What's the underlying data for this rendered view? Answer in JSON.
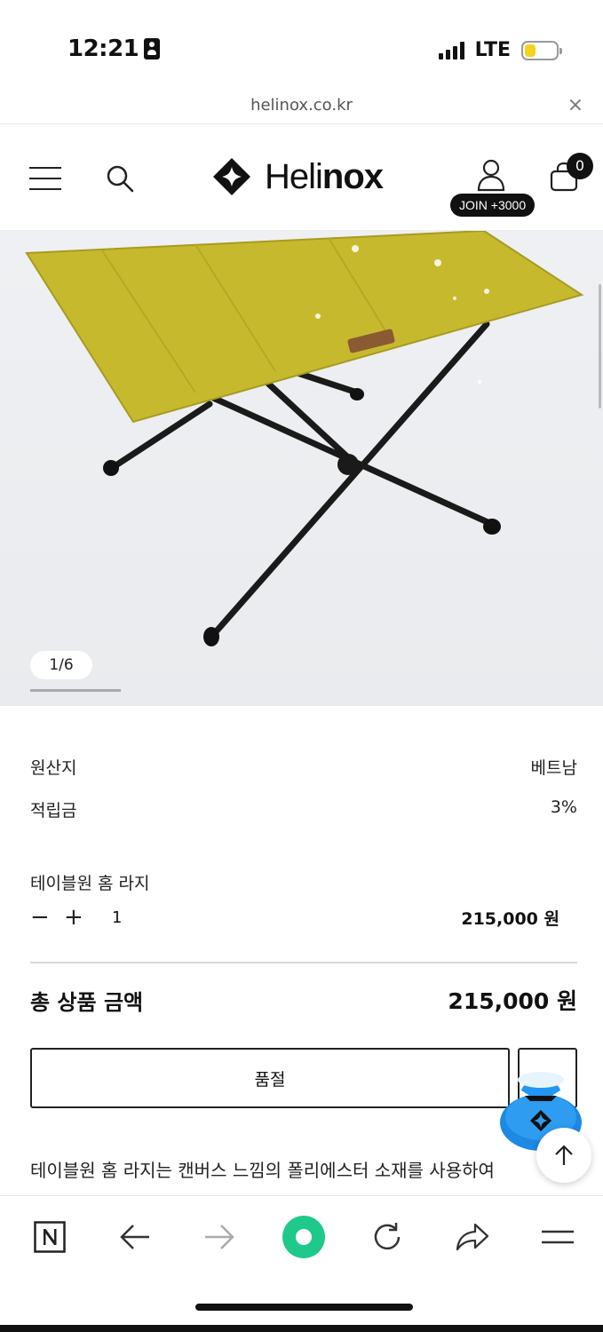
{
  "status_bar": {
    "time": "12:21",
    "network": "LTE",
    "battery_level": 0.35,
    "battery_color": "#f4d21f"
  },
  "browser": {
    "url": "helinox.co.kr",
    "close_symbol": "×"
  },
  "header": {
    "logo_light": "Heli",
    "logo_bold": "nox",
    "join_badge": "JOIN +3000",
    "cart_count": "0"
  },
  "product_gallery": {
    "counter": "1/6",
    "image_alt": "테이블원 홈 라지",
    "table_color": "#c7b92e"
  },
  "product_info": {
    "origin_label": "원산지",
    "origin_value": "베트남",
    "points_label": "적립금",
    "points_value": "3%"
  },
  "option": {
    "name": "테이블원 홈 라지",
    "minus_symbol": "−",
    "plus_symbol": "+",
    "quantity": "1",
    "price": "215,000 원"
  },
  "total": {
    "label": "총 상품 금액",
    "value": "215,000 원"
  },
  "actions": {
    "soldout_label": "품절"
  },
  "description": "테이블원 홈 라지는 캔버스 느낌의 폴리에스터 소재를 사용하여",
  "colors": {
    "accent_green": "#1ec98a",
    "text": "#111111"
  }
}
